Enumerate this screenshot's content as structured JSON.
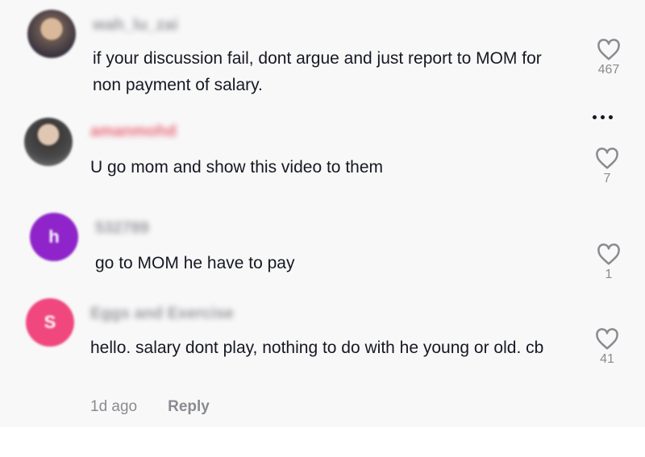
{
  "comments": [
    {
      "username": "wah_lu_zai",
      "avatar_type": "photo",
      "text": "if your discussion fail, dont argue and just report to MOM for non payment of salary.",
      "likes": "467"
    },
    {
      "username": "amanmohd",
      "avatar_type": "photo",
      "text": "U go mom and show this video to them",
      "likes": "7"
    },
    {
      "username": "532789",
      "avatar_type": "letter",
      "avatar_letter": "h",
      "avatar_color": "#8e24c9",
      "text": "go to MOM he have to pay",
      "likes": "1"
    },
    {
      "username": "Eggs and Exercise",
      "avatar_type": "letter",
      "avatar_letter": "S",
      "avatar_color": "#f0477e",
      "text": "hello. salary dont play, nothing to do with he young or old. cb",
      "likes": "41",
      "timestamp": "1d ago",
      "reply_label": "Reply"
    }
  ],
  "icons": {
    "like": "heart-outline-icon",
    "more": "more-horizontal-icon"
  }
}
